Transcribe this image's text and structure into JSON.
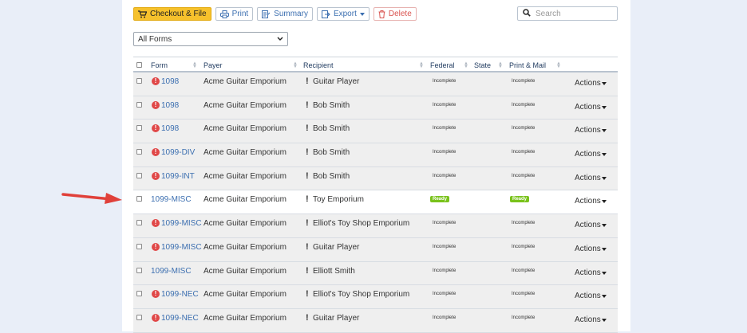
{
  "toolbar": {
    "checkout_label": "Checkout & File",
    "print_label": "Print",
    "summary_label": "Summary",
    "export_label": "Export",
    "delete_label": "Delete"
  },
  "search": {
    "placeholder": "Search"
  },
  "filter": {
    "selected": "All Forms"
  },
  "table": {
    "headers": {
      "form": "Form",
      "payer": "Payer",
      "recipient": "Recipient",
      "federal": "Federal",
      "state": "State",
      "print_mail": "Print & Mail"
    },
    "actions_label": "Actions",
    "rows": [
      {
        "form": "1098",
        "payer": "Acme Guitar Emporium",
        "recipient": "Guitar Player",
        "federal": "Incomplete",
        "print_mail": "Incomplete",
        "error": true,
        "ready": false
      },
      {
        "form": "1098",
        "payer": "Acme Guitar Emporium",
        "recipient": "Bob Smith",
        "federal": "Incomplete",
        "print_mail": "Incomplete",
        "error": true,
        "ready": false
      },
      {
        "form": "1098",
        "payer": "Acme Guitar Emporium",
        "recipient": "Bob Smith",
        "federal": "Incomplete",
        "print_mail": "Incomplete",
        "error": true,
        "ready": false
      },
      {
        "form": "1099-DIV",
        "payer": "Acme Guitar Emporium",
        "recipient": "Bob Smith",
        "federal": "Incomplete",
        "print_mail": "Incomplete",
        "error": true,
        "ready": false
      },
      {
        "form": "1099-INT",
        "payer": "Acme Guitar Emporium",
        "recipient": "Bob Smith",
        "federal": "Incomplete",
        "print_mail": "Incomplete",
        "error": true,
        "ready": false
      },
      {
        "form": "1099-MISC",
        "payer": "Acme Guitar Emporium",
        "recipient": "Toy Emporium",
        "federal": "Ready",
        "print_mail": "Ready",
        "error": false,
        "ready": true
      },
      {
        "form": "1099-MISC",
        "payer": "Acme Guitar Emporium",
        "recipient": "Elliot's Toy Shop Emporium",
        "federal": "Incomplete",
        "print_mail": "Incomplete",
        "error": true,
        "ready": false
      },
      {
        "form": "1099-MISC",
        "payer": "Acme Guitar Emporium",
        "recipient": "Guitar Player",
        "federal": "Incomplete",
        "print_mail": "Incomplete",
        "error": true,
        "ready": false
      },
      {
        "form": "1099-MISC",
        "payer": "Acme Guitar Emporium",
        "recipient": "Elliott Smith",
        "federal": "Incomplete",
        "print_mail": "Incomplete",
        "error": false,
        "ready": false
      },
      {
        "form": "1099-NEC",
        "payer": "Acme Guitar Emporium",
        "recipient": "Elliot's Toy Shop Emporium",
        "federal": "Incomplete",
        "print_mail": "Incomplete",
        "error": true,
        "ready": false
      },
      {
        "form": "1099-NEC",
        "payer": "Acme Guitar Emporium",
        "recipient": "Guitar Player",
        "federal": "Incomplete",
        "print_mail": "Incomplete",
        "error": true,
        "ready": false
      }
    ]
  },
  "colors": {
    "primary_button": "#f6c12c",
    "link_blue": "#3c6fb0",
    "error_red": "#e04848",
    "ready_green": "#79c21b",
    "arrow_red": "#e0403a"
  }
}
